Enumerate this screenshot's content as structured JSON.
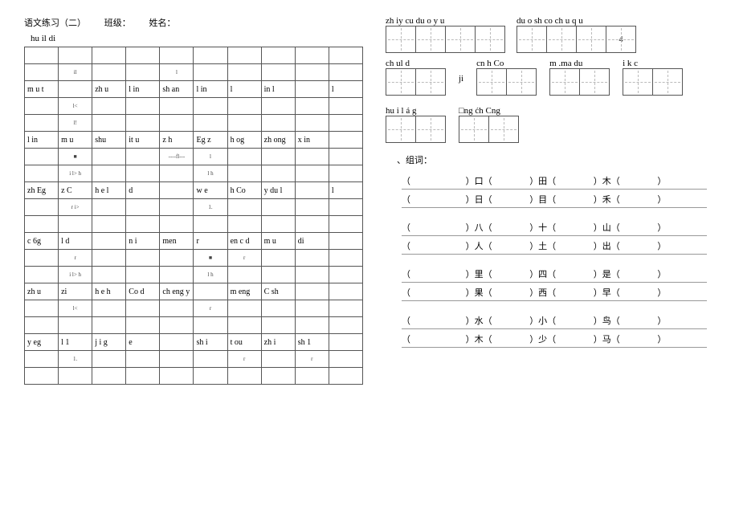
{
  "header": {
    "title": "语文练习（二）",
    "class": "班级：",
    "name": "姓名："
  },
  "left": {
    "sub": "hu il di",
    "rows": [
      {
        "type": "tiny",
        "cells": [
          "",
          "",
          "",
          "",
          "",
          "",
          "",
          "",
          "",
          ""
        ]
      },
      {
        "type": "tiny",
        "cells": [
          "",
          "il",
          "",
          "",
          "l",
          "",
          "",
          "",
          "",
          ""
        ]
      },
      {
        "type": "lbl",
        "cells": [
          "m u t",
          "",
          "zh u",
          "l in",
          "sh an",
          "l in",
          "l",
          "in l",
          "",
          "l"
        ]
      },
      {
        "type": "tiny",
        "cells": [
          "",
          "l<",
          "",
          "",
          "",
          "",
          "",
          "",
          "",
          ""
        ]
      },
      {
        "type": "tiny",
        "cells": [
          "",
          "l!",
          "",
          "",
          "",
          "",
          "",
          "",
          "",
          ""
        ]
      },
      {
        "type": "lbl",
        "cells": [
          "l in",
          "m u",
          "shu",
          "it u",
          "z h",
          "Eg z",
          "h og",
          "zh ong",
          "x in",
          ""
        ]
      },
      {
        "type": "tiny",
        "cells": [
          "",
          "■",
          "",
          "",
          "----fl---",
          "l",
          "",
          "",
          "",
          ""
        ]
      },
      {
        "type": "tiny",
        "cells": [
          "",
          "i l> h",
          "",
          "",
          "",
          "l h",
          "",
          "",
          "",
          ""
        ]
      },
      {
        "type": "lbl",
        "cells": [
          "zh Eg",
          "z C",
          "h e l",
          "d",
          "",
          "w e",
          "h Co",
          "y du l",
          "",
          "l"
        ]
      },
      {
        "type": "tiny",
        "cells": [
          "",
          "r i>",
          "",
          "",
          "",
          "1.",
          "",
          "",
          "",
          ""
        ]
      },
      {
        "type": "tiny",
        "cells": [
          "",
          "",
          "",
          "",
          "",
          "",
          "",
          "",
          "",
          ""
        ]
      },
      {
        "type": "lbl",
        "cells": [
          "c 6g",
          "l d",
          "",
          "n i",
          "men",
          "r",
          "en c d",
          "m u",
          "di",
          ""
        ]
      },
      {
        "type": "tiny",
        "cells": [
          "",
          "r",
          "",
          "",
          "",
          "■",
          "r",
          "",
          "",
          ""
        ]
      },
      {
        "type": "tiny",
        "cells": [
          "",
          "i l> h",
          "",
          "",
          "",
          "l h",
          "",
          "",
          "",
          ""
        ]
      },
      {
        "type": "lbl",
        "cells": [
          "zh u",
          "zi",
          "h e h",
          "Co d",
          "ch eng y",
          "",
          "m eng",
          "C sh",
          "",
          ""
        ]
      },
      {
        "type": "tiny",
        "cells": [
          "",
          "l<",
          "",
          "",
          "",
          "r",
          "",
          "",
          "",
          ""
        ]
      },
      {
        "type": "tiny",
        "cells": [
          "",
          "",
          "",
          "",
          "",
          "",
          "",
          "",
          "",
          ""
        ]
      },
      {
        "type": "lbl",
        "cells": [
          "y eg",
          "l 1",
          "j i g",
          "e",
          "",
          "sh i",
          "t ou",
          "zh i",
          "sh 1",
          ""
        ]
      },
      {
        "type": "tiny",
        "cells": [
          "",
          "1.",
          "",
          "",
          "",
          "",
          "r",
          "",
          "r",
          ""
        ]
      },
      {
        "type": "tiny",
        "cells": [
          "",
          "",
          "",
          "",
          "",
          "",
          "",
          "",
          "",
          ""
        ]
      }
    ]
  },
  "right": {
    "row1": [
      {
        "label": "zh iy cu du o y u",
        "cells": 4
      },
      {
        "label": "du o sh co   ch u q u",
        "cells": 4,
        "extra": "4"
      }
    ],
    "row2": [
      {
        "label": "ch ul d",
        "cells": 2
      },
      {
        "label": "ji",
        "cells": null
      },
      {
        "label": "cn h Co",
        "cells": 2
      },
      {
        "label": "m  .ma du",
        "cells": 2
      },
      {
        "label": "i k c",
        "cells": 2
      }
    ],
    "row3": [
      {
        "label": "hu i l  á  g",
        "cells": 2
      },
      {
        "label": "□ng ćh Cng",
        "cells": 2
      }
    ],
    "zuci": "、组词：",
    "groups": [
      [
        [
          "（",
          "）口（",
          "）田（",
          "）木（",
          "）"
        ],
        [
          "（",
          "）日（",
          "）目（",
          "）禾（",
          "）"
        ]
      ],
      [
        [
          "（",
          "）八（",
          "）十（",
          "）山（",
          "）"
        ],
        [
          "（",
          "）人（",
          "）土（",
          "）出（",
          "）"
        ]
      ],
      [
        [
          "（",
          "）里（",
          "）四（",
          "）是（",
          "）"
        ],
        [
          "（",
          "）果（",
          "）西（",
          "）早（",
          "）"
        ]
      ],
      [
        [
          "（",
          "）水（",
          "）小（",
          "）鸟（",
          "）"
        ],
        [
          "（",
          "）木（",
          "）少（",
          "）马（",
          "）"
        ]
      ]
    ]
  }
}
